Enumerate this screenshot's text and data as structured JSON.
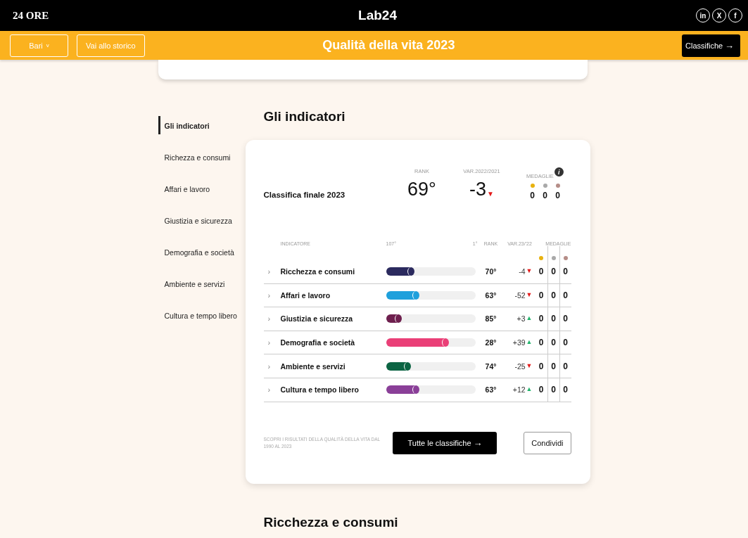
{
  "topbar": {
    "logo": "24 ORE",
    "brand": "Lab24",
    "social": [
      "in",
      "X",
      "f"
    ]
  },
  "subbar": {
    "city": "Bari",
    "city_caret": "v",
    "history": "Vai allo storico",
    "title": "Qualità della vita 2023",
    "rankings": "Classifiche",
    "rankings_arrow": "→"
  },
  "sidebar": {
    "items": [
      {
        "label": "Gli indicatori",
        "selected": true
      },
      {
        "label": "Richezza e consumi",
        "selected": false
      },
      {
        "label": "Affari e lavoro",
        "selected": false
      },
      {
        "label": "Giustizia e sicurezza",
        "selected": false
      },
      {
        "label": "Demografia e società",
        "selected": false
      },
      {
        "label": "Ambiente e servizi",
        "selected": false
      },
      {
        "label": "Cultura e tempo libero",
        "selected": false
      }
    ]
  },
  "section_title": "Gli indicatori",
  "summary": {
    "label": "Classifica finale 2023",
    "rank_label": "RANK",
    "rank": "69°",
    "var_label": "VAR.2022/2021",
    "variation": {
      "value": "-3",
      "arrow": "▼",
      "kind": "down"
    },
    "medals_label": "MEDAGLIE",
    "info": "i",
    "medals": [
      {
        "color": "#e8b20f",
        "count": "0"
      },
      {
        "color": "#a9a9a9",
        "count": "0"
      },
      {
        "color": "#b58d87",
        "count": "0"
      }
    ]
  },
  "table": {
    "columns": {
      "indicator": "INDICATORE",
      "scale_low": "107°",
      "scale_high": "1°",
      "rank": "RANK",
      "var": "VAR.23/'22",
      "medals": "MEDAGLIE"
    },
    "medal_dots": [
      {
        "color": "#e8b20f"
      },
      {
        "color": "#a9a9a9"
      },
      {
        "color": "#b58d87"
      }
    ],
    "rows": [
      {
        "chevron": "›",
        "name": "Ricchezza e consumi",
        "color": "#2b2a5e",
        "level": 0.31,
        "rank": "70°",
        "var": "-4",
        "arrow": "▼",
        "kind": "down",
        "medals": [
          "0",
          "0",
          "0"
        ]
      },
      {
        "chevron": "›",
        "name": "Affari e lavoro",
        "color": "#1ea0dc",
        "level": 0.37,
        "rank": "63°",
        "var": "-52",
        "arrow": "▼",
        "kind": "down",
        "medals": [
          "0",
          "0",
          "0"
        ]
      },
      {
        "chevron": "›",
        "name": "Giustizia e sicurezza",
        "color": "#6e1f4e",
        "level": 0.17,
        "rank": "85°",
        "var": "+3",
        "arrow": "▲",
        "kind": "up",
        "medals": [
          "0",
          "0",
          "0"
        ]
      },
      {
        "chevron": "›",
        "name": "Demografia e società",
        "color": "#ea3f77",
        "level": 0.7,
        "rank": "28°",
        "var": "+39",
        "arrow": "▲",
        "kind": "up",
        "medals": [
          "0",
          "0",
          "0"
        ]
      },
      {
        "chevron": "›",
        "name": "Ambiente e servizi",
        "color": "#0c6443",
        "level": 0.27,
        "rank": "74°",
        "var": "-25",
        "arrow": "▼",
        "kind": "down",
        "medals": [
          "0",
          "0",
          "0"
        ]
      },
      {
        "chevron": "›",
        "name": "Cultura e tempo libero",
        "color": "#8a3f98",
        "level": 0.37,
        "rank": "63°",
        "var": "+12",
        "arrow": "▲",
        "kind": "up",
        "medals": [
          "0",
          "0",
          "0"
        ]
      }
    ]
  },
  "footer": {
    "note": "SCOPRI I RISULTATI DELLA QUALITÀ DELLA VITA DAL 1990 AL 2023",
    "all_button": "Tutte le classifiche",
    "all_arrow": "→",
    "share_button": "Condividi"
  },
  "next_section_title": "Ricchezza e consumi"
}
